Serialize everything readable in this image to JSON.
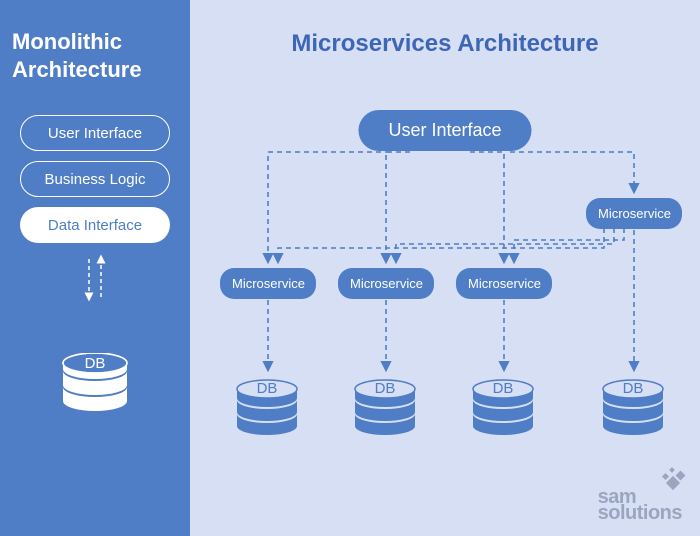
{
  "left": {
    "title": "Monolithic Architecture",
    "layers": [
      "User Interface",
      "Business Logic",
      "Data Interface"
    ],
    "db_label": "DB"
  },
  "right": {
    "title": "Microservices Architecture",
    "ui_label": "User Interface",
    "microservice_label": "Microservice",
    "db_label": "DB"
  },
  "logo": {
    "line1": "sam",
    "line2": "solutions"
  },
  "colors": {
    "brand_blue": "#4f7ec7",
    "bg_light": "#d7dff5",
    "logo_gray": "#9aa6bf"
  }
}
